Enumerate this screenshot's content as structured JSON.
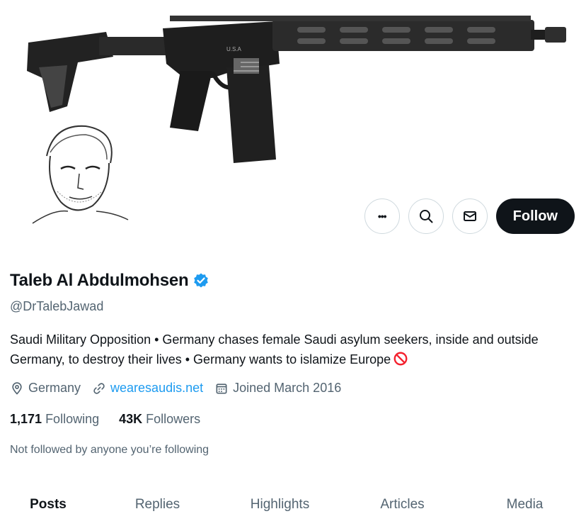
{
  "profile": {
    "display_name": "Taleb Al Abdulmohsen",
    "handle": "@DrTalebJawad",
    "bio": "Saudi Military Opposition • Germany chases female Saudi asylum seekers, inside and outside Germany, to destroy their lives • Germany wants to islamize Europe",
    "location": "Germany",
    "website": "wearesaudis.net",
    "joined": "Joined March 2016",
    "following_count": "1,171",
    "following_label": "Following",
    "followers_count": "43K",
    "followers_label": "Followers",
    "not_followed_text": "Not followed by anyone you’re following",
    "banner_text": "U.S.A"
  },
  "actions": {
    "more_label": "•••",
    "follow_label": "Follow"
  },
  "tabs": [
    {
      "label": "Posts"
    },
    {
      "label": "Replies"
    },
    {
      "label": "Highlights"
    },
    {
      "label": "Articles"
    },
    {
      "label": "Media"
    }
  ],
  "colors": {
    "accent": "#1d9bf0",
    "text": "#0f1419",
    "secondary": "#536471",
    "follow_button": "#0f1419",
    "prohibited": "#f4212e"
  },
  "icons": [
    "more-icon",
    "search-icon",
    "mail-icon",
    "verified-badge-icon",
    "prohibited-icon",
    "location-icon",
    "link-icon",
    "calendar-icon"
  ]
}
